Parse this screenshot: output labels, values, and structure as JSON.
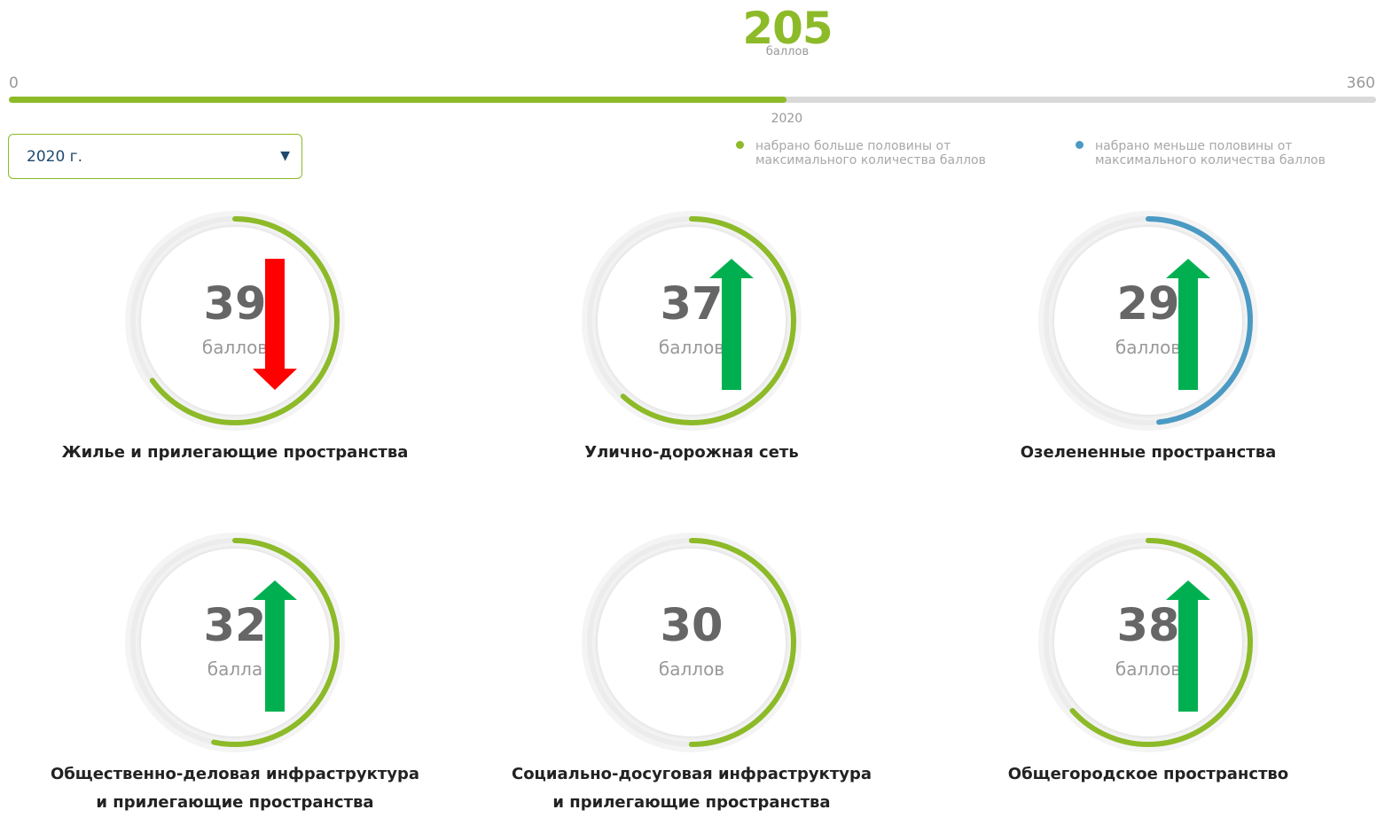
{
  "summary": {
    "total_score": "205",
    "total_unit": "баллов",
    "scale_min": "0",
    "scale_max": "360",
    "progress_fraction": 0.569,
    "progress_label": "2020"
  },
  "year_select": {
    "value": "2020 г."
  },
  "legend": {
    "above_half": "набрано больше половины от максимального количества баллов",
    "below_half": "набрано меньше половины от максимального количества баллов"
  },
  "colors": {
    "above_half": "#8dba28",
    "below_half": "#4b9ac4",
    "trend_up": "#00b050",
    "trend_down": "#ff0000"
  },
  "categories": [
    {
      "score": "39",
      "unit": "баллов",
      "fraction": 0.65,
      "status": "above_half",
      "trend": "down",
      "title_line1": "Жилье и прилегающие пространства",
      "title_line2": ""
    },
    {
      "score": "37",
      "unit": "баллов",
      "fraction": 0.617,
      "status": "above_half",
      "trend": "up",
      "title_line1": "Улично-дорожная сеть",
      "title_line2": ""
    },
    {
      "score": "29",
      "unit": "баллов",
      "fraction": 0.483,
      "status": "below_half",
      "trend": "up",
      "title_line1": "Озелененные пространства",
      "title_line2": ""
    },
    {
      "score": "32",
      "unit": "балла",
      "fraction": 0.533,
      "status": "above_half",
      "trend": "up",
      "title_line1": "Общественно-деловая инфраструктура",
      "title_line2": "и прилегающие пространства"
    },
    {
      "score": "30",
      "unit": "баллов",
      "fraction": 0.5,
      "status": "above_half",
      "trend": "none",
      "title_line1": "Социально-досуговая инфраструктура",
      "title_line2": "и прилегающие пространства"
    },
    {
      "score": "38",
      "unit": "баллов",
      "fraction": 0.633,
      "status": "above_half",
      "trend": "up",
      "title_line1": "Общегородское пространство",
      "title_line2": ""
    }
  ]
}
